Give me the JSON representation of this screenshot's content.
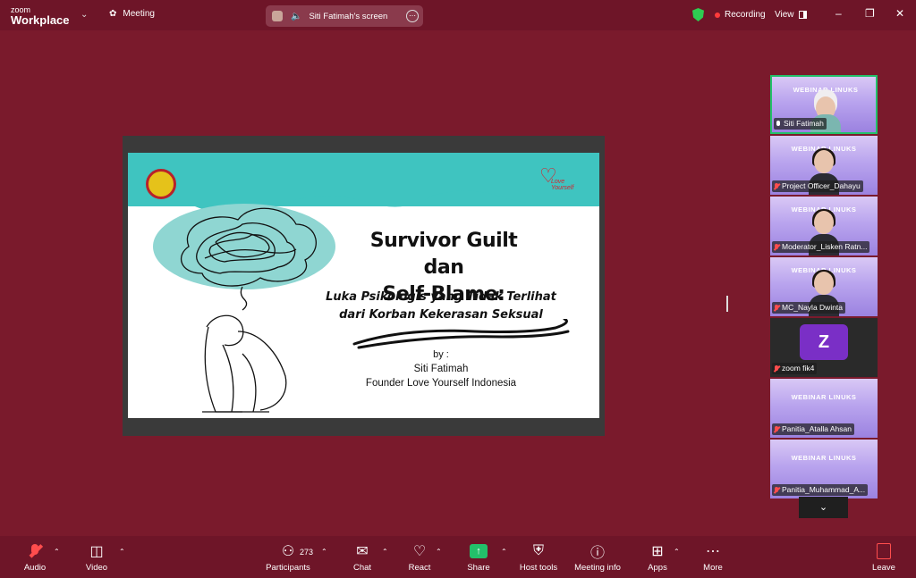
{
  "titlebar": {
    "brand_line1": "zoom",
    "brand_line2": "Workplace",
    "meeting_label": "Meeting",
    "screen_label": "Siti Fatimah's screen",
    "recording_label": "Recording",
    "view_label": "View"
  },
  "slide": {
    "title_line1": "Survivor Guilt dan",
    "title_line2": "Self-Blame:",
    "subtitle_line1": "Luka Psikologis yang Tidak Terlihat",
    "subtitle_line2": "dari Korban Kekerasan Seksual",
    "by_label": "by :",
    "presenter_name": "Siti Fatimah",
    "presenter_role": "Founder Love Yourself Indonesia",
    "logo_text_1": "Love",
    "logo_text_2": "Yourself"
  },
  "participants": [
    {
      "name": "Siti Fatimah",
      "active": true,
      "video": "person-hijab"
    },
    {
      "name": "Project Officer_Dahayu",
      "video": "person"
    },
    {
      "name": "Moderator_Lisken Ratn...",
      "video": "person"
    },
    {
      "name": "MC_Nayla Dwinta",
      "video": "person"
    },
    {
      "name": "zoom fik4",
      "avatar_letter": "Z",
      "video": "off"
    },
    {
      "name": "Panitia_Atalla Ahsan",
      "video": "banner"
    },
    {
      "name": "Panitia_Muhammad_A...",
      "video": "banner"
    }
  ],
  "tile_banner_text": "WEBINAR LINUKS",
  "toolbar": {
    "audio": "Audio",
    "video": "Video",
    "participants": "Participants",
    "participants_count": "273",
    "chat": "Chat",
    "react": "React",
    "share": "Share",
    "host_tools": "Host tools",
    "meeting_info": "Meeting info",
    "apps": "Apps",
    "more": "More",
    "leave": "Leave"
  },
  "colors": {
    "background": "#7a1a2c",
    "toolbar": "#6e1528",
    "share_green": "#23c06a",
    "slide_teal": "#3fc4c0"
  }
}
